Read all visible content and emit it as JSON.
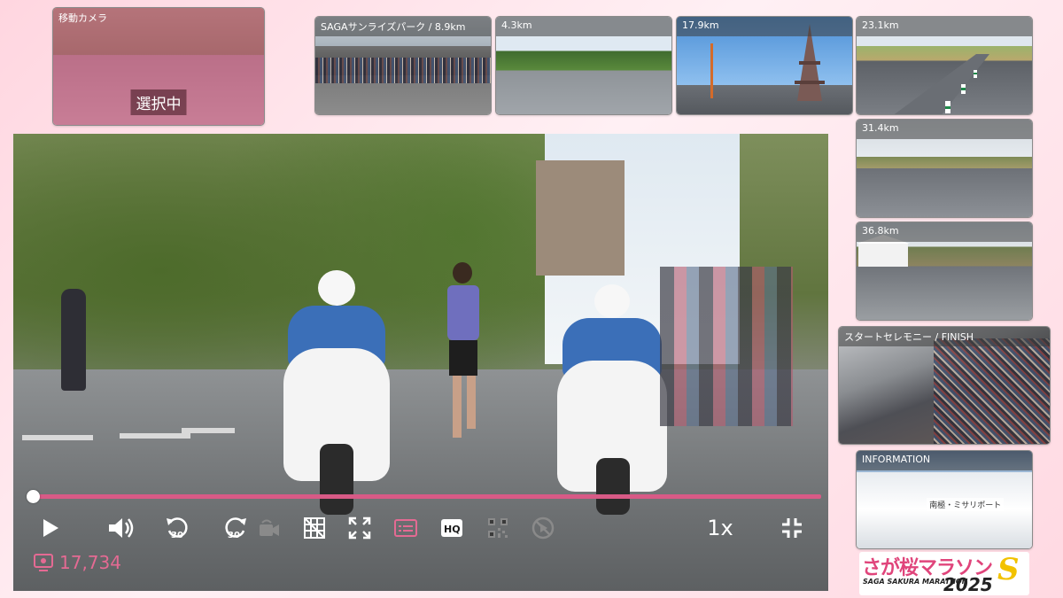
{
  "mobile_camera": {
    "label": "移動カメラ",
    "selected_text": "選択中"
  },
  "cameras": [
    {
      "label": "SAGAサンライズパーク / 8.9km"
    },
    {
      "label": "4.3km"
    },
    {
      "label": "17.9km"
    },
    {
      "label": "23.1km"
    },
    {
      "label": "31.4km"
    },
    {
      "label": "36.8km"
    },
    {
      "label": "スタートセレモニー / FINISH"
    },
    {
      "label": "INFORMATION",
      "scene_text": "南極・ミサリポート"
    }
  ],
  "player": {
    "progress": 0.0,
    "speed_label": "1x",
    "view_count": "17,734",
    "colors": {
      "accent": "#d85a86",
      "views": "#e46a93",
      "inactive": "#8a8a8a"
    },
    "icons": [
      "play-icon",
      "volume-icon",
      "rewind-30-icon",
      "forward-30-icon",
      "camera-switch-icon",
      "grid-icon",
      "expand-icon",
      "subtitles-icon",
      "hq-icon",
      "qr-icon",
      "no-tracking-icon",
      "exit-fullscreen-icon"
    ],
    "icon_text": {
      "rewind": "30",
      "forward": "30",
      "hq": "HQ"
    }
  },
  "logo": {
    "title": "さが桜マラソン",
    "subtitle": "SAGA SAKURA MARATHON",
    "year": "2025",
    "mark": "S"
  }
}
